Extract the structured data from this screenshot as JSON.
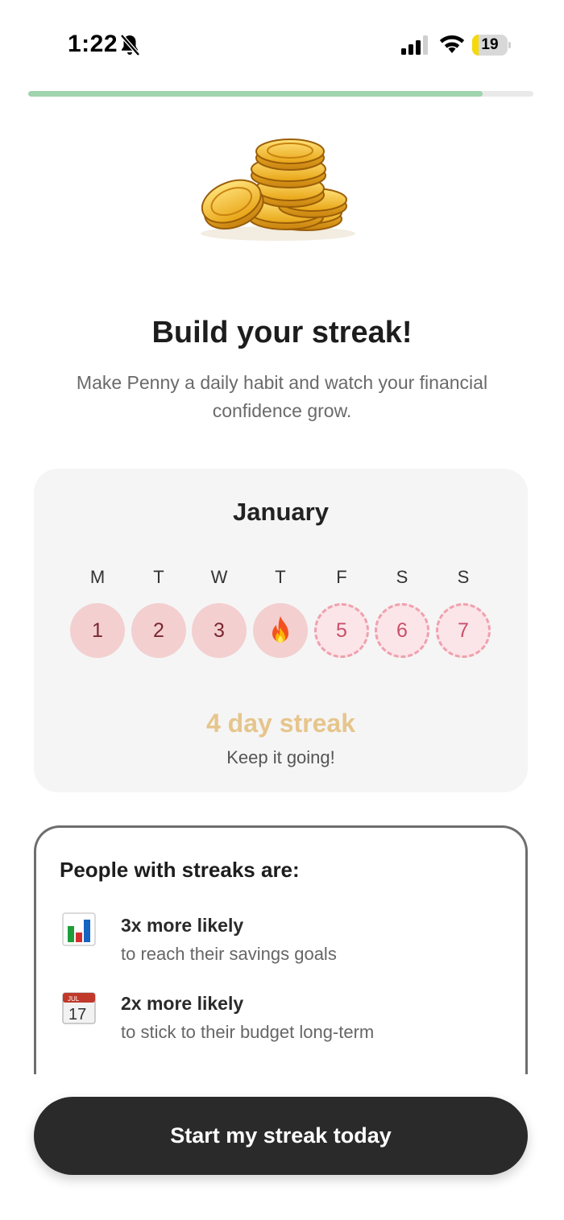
{
  "status_bar": {
    "time": "1:22",
    "battery_level": "19",
    "battery_fraction": 0.19,
    "icons": [
      "bell-slash-icon",
      "cellular-signal-icon",
      "wifi-icon",
      "battery-icon"
    ]
  },
  "progress": {
    "fraction": 0.9
  },
  "hero": {
    "icon": "gold-coins-stack",
    "title": "Build your streak!",
    "subtitle": "Make Penny a daily habit and watch your financial confidence grow."
  },
  "calendar": {
    "month": "January",
    "weekdays": [
      "M",
      "T",
      "W",
      "T",
      "F",
      "S",
      "S"
    ],
    "days": [
      {
        "label": "1",
        "state": "done"
      },
      {
        "label": "2",
        "state": "done"
      },
      {
        "label": "3",
        "state": "done"
      },
      {
        "label": "",
        "state": "today",
        "icon": "fire-icon"
      },
      {
        "label": "5",
        "state": "future"
      },
      {
        "label": "6",
        "state": "future"
      },
      {
        "label": "7",
        "state": "future"
      }
    ],
    "streak_count": "4 day streak",
    "streak_message": "Keep it going!"
  },
  "stats": {
    "title": "People with streaks are:",
    "items": [
      {
        "icon": "bar-chart-icon",
        "headline": "3x more likely",
        "description": "to reach their savings goals"
      },
      {
        "icon": "calendar-icon",
        "headline": "2x more likely",
        "description": "to stick to their budget long-term"
      }
    ]
  },
  "colors": {
    "progress": "#9fd4ad",
    "streak_text": "#e6c58c",
    "day_done": "#f3cfd0",
    "day_future_border": "#f0a0ae",
    "cta_bg": "#2a2a2a"
  },
  "cta": {
    "label": "Start my streak today"
  }
}
